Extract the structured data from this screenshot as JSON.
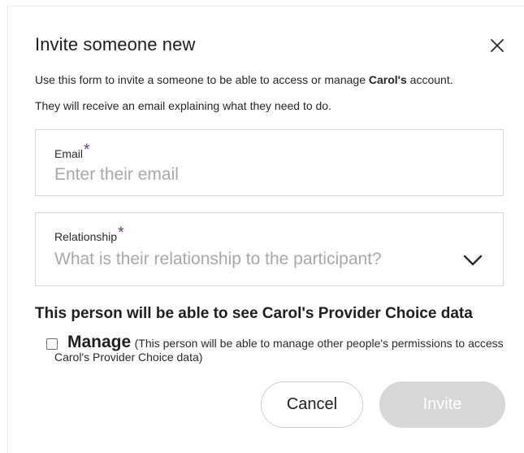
{
  "dialog": {
    "title": "Invite someone new",
    "close_icon": "close-icon",
    "description_line1_prefix": "Use this form to invite a someone to be able to access or manage ",
    "description_line1_name": "Carol's",
    "description_line1_suffix": " account.",
    "description_line2": "They will receive an email explaining what they need to do."
  },
  "email_field": {
    "label": "Email",
    "required_marker": "*",
    "placeholder": "Enter their email",
    "value": ""
  },
  "relationship_field": {
    "label": "Relationship",
    "required_marker": "*",
    "placeholder": "What is their relationship to the participant?",
    "icon": "chevron-down-icon"
  },
  "permissions": {
    "heading": "This person will be able to see Carol's Provider Choice data",
    "manage_label": "Manage",
    "manage_description": "(This person will be able to manage other people's permissions to access Carol's Provider Choice data)",
    "manage_checked": false
  },
  "actions": {
    "cancel_label": "Cancel",
    "invite_label": "Invite",
    "invite_disabled": true
  },
  "colors": {
    "required_accent": "#6b2fa0",
    "invite_disabled_bg": "#d7d7d7"
  }
}
